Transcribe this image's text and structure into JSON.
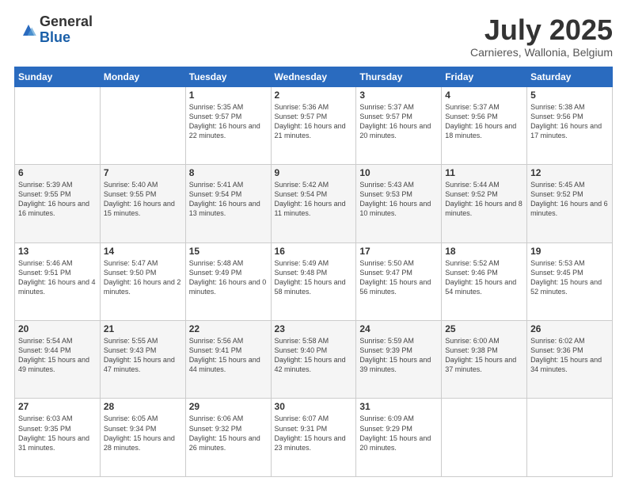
{
  "header": {
    "logo": {
      "general": "General",
      "blue": "Blue"
    },
    "title": "July 2025",
    "location": "Carnieres, Wallonia, Belgium"
  },
  "weekdays": [
    "Sunday",
    "Monday",
    "Tuesday",
    "Wednesday",
    "Thursday",
    "Friday",
    "Saturday"
  ],
  "weeks": [
    [
      {
        "day": "",
        "sunrise": "",
        "sunset": "",
        "daylight": ""
      },
      {
        "day": "",
        "sunrise": "",
        "sunset": "",
        "daylight": ""
      },
      {
        "day": "1",
        "sunrise": "Sunrise: 5:35 AM",
        "sunset": "Sunset: 9:57 PM",
        "daylight": "Daylight: 16 hours and 22 minutes."
      },
      {
        "day": "2",
        "sunrise": "Sunrise: 5:36 AM",
        "sunset": "Sunset: 9:57 PM",
        "daylight": "Daylight: 16 hours and 21 minutes."
      },
      {
        "day": "3",
        "sunrise": "Sunrise: 5:37 AM",
        "sunset": "Sunset: 9:57 PM",
        "daylight": "Daylight: 16 hours and 20 minutes."
      },
      {
        "day": "4",
        "sunrise": "Sunrise: 5:37 AM",
        "sunset": "Sunset: 9:56 PM",
        "daylight": "Daylight: 16 hours and 18 minutes."
      },
      {
        "day": "5",
        "sunrise": "Sunrise: 5:38 AM",
        "sunset": "Sunset: 9:56 PM",
        "daylight": "Daylight: 16 hours and 17 minutes."
      }
    ],
    [
      {
        "day": "6",
        "sunrise": "Sunrise: 5:39 AM",
        "sunset": "Sunset: 9:55 PM",
        "daylight": "Daylight: 16 hours and 16 minutes."
      },
      {
        "day": "7",
        "sunrise": "Sunrise: 5:40 AM",
        "sunset": "Sunset: 9:55 PM",
        "daylight": "Daylight: 16 hours and 15 minutes."
      },
      {
        "day": "8",
        "sunrise": "Sunrise: 5:41 AM",
        "sunset": "Sunset: 9:54 PM",
        "daylight": "Daylight: 16 hours and 13 minutes."
      },
      {
        "day": "9",
        "sunrise": "Sunrise: 5:42 AM",
        "sunset": "Sunset: 9:54 PM",
        "daylight": "Daylight: 16 hours and 11 minutes."
      },
      {
        "day": "10",
        "sunrise": "Sunrise: 5:43 AM",
        "sunset": "Sunset: 9:53 PM",
        "daylight": "Daylight: 16 hours and 10 minutes."
      },
      {
        "day": "11",
        "sunrise": "Sunrise: 5:44 AM",
        "sunset": "Sunset: 9:52 PM",
        "daylight": "Daylight: 16 hours and 8 minutes."
      },
      {
        "day": "12",
        "sunrise": "Sunrise: 5:45 AM",
        "sunset": "Sunset: 9:52 PM",
        "daylight": "Daylight: 16 hours and 6 minutes."
      }
    ],
    [
      {
        "day": "13",
        "sunrise": "Sunrise: 5:46 AM",
        "sunset": "Sunset: 9:51 PM",
        "daylight": "Daylight: 16 hours and 4 minutes."
      },
      {
        "day": "14",
        "sunrise": "Sunrise: 5:47 AM",
        "sunset": "Sunset: 9:50 PM",
        "daylight": "Daylight: 16 hours and 2 minutes."
      },
      {
        "day": "15",
        "sunrise": "Sunrise: 5:48 AM",
        "sunset": "Sunset: 9:49 PM",
        "daylight": "Daylight: 16 hours and 0 minutes."
      },
      {
        "day": "16",
        "sunrise": "Sunrise: 5:49 AM",
        "sunset": "Sunset: 9:48 PM",
        "daylight": "Daylight: 15 hours and 58 minutes."
      },
      {
        "day": "17",
        "sunrise": "Sunrise: 5:50 AM",
        "sunset": "Sunset: 9:47 PM",
        "daylight": "Daylight: 15 hours and 56 minutes."
      },
      {
        "day": "18",
        "sunrise": "Sunrise: 5:52 AM",
        "sunset": "Sunset: 9:46 PM",
        "daylight": "Daylight: 15 hours and 54 minutes."
      },
      {
        "day": "19",
        "sunrise": "Sunrise: 5:53 AM",
        "sunset": "Sunset: 9:45 PM",
        "daylight": "Daylight: 15 hours and 52 minutes."
      }
    ],
    [
      {
        "day": "20",
        "sunrise": "Sunrise: 5:54 AM",
        "sunset": "Sunset: 9:44 PM",
        "daylight": "Daylight: 15 hours and 49 minutes."
      },
      {
        "day": "21",
        "sunrise": "Sunrise: 5:55 AM",
        "sunset": "Sunset: 9:43 PM",
        "daylight": "Daylight: 15 hours and 47 minutes."
      },
      {
        "day": "22",
        "sunrise": "Sunrise: 5:56 AM",
        "sunset": "Sunset: 9:41 PM",
        "daylight": "Daylight: 15 hours and 44 minutes."
      },
      {
        "day": "23",
        "sunrise": "Sunrise: 5:58 AM",
        "sunset": "Sunset: 9:40 PM",
        "daylight": "Daylight: 15 hours and 42 minutes."
      },
      {
        "day": "24",
        "sunrise": "Sunrise: 5:59 AM",
        "sunset": "Sunset: 9:39 PM",
        "daylight": "Daylight: 15 hours and 39 minutes."
      },
      {
        "day": "25",
        "sunrise": "Sunrise: 6:00 AM",
        "sunset": "Sunset: 9:38 PM",
        "daylight": "Daylight: 15 hours and 37 minutes."
      },
      {
        "day": "26",
        "sunrise": "Sunrise: 6:02 AM",
        "sunset": "Sunset: 9:36 PM",
        "daylight": "Daylight: 15 hours and 34 minutes."
      }
    ],
    [
      {
        "day": "27",
        "sunrise": "Sunrise: 6:03 AM",
        "sunset": "Sunset: 9:35 PM",
        "daylight": "Daylight: 15 hours and 31 minutes."
      },
      {
        "day": "28",
        "sunrise": "Sunrise: 6:05 AM",
        "sunset": "Sunset: 9:34 PM",
        "daylight": "Daylight: 15 hours and 28 minutes."
      },
      {
        "day": "29",
        "sunrise": "Sunrise: 6:06 AM",
        "sunset": "Sunset: 9:32 PM",
        "daylight": "Daylight: 15 hours and 26 minutes."
      },
      {
        "day": "30",
        "sunrise": "Sunrise: 6:07 AM",
        "sunset": "Sunset: 9:31 PM",
        "daylight": "Daylight: 15 hours and 23 minutes."
      },
      {
        "day": "31",
        "sunrise": "Sunrise: 6:09 AM",
        "sunset": "Sunset: 9:29 PM",
        "daylight": "Daylight: 15 hours and 20 minutes."
      },
      {
        "day": "",
        "sunrise": "",
        "sunset": "",
        "daylight": ""
      },
      {
        "day": "",
        "sunrise": "",
        "sunset": "",
        "daylight": ""
      }
    ]
  ]
}
